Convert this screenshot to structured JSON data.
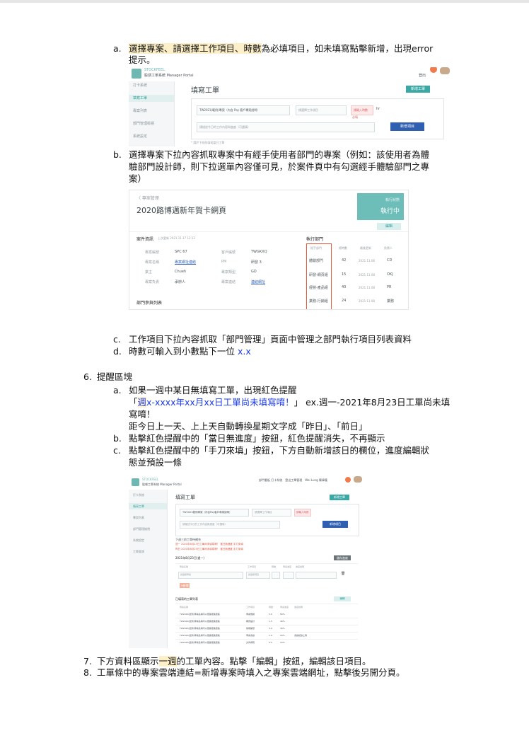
{
  "doc": {
    "item_a_marker": "a.",
    "item_a_line1_parts": [
      "選擇專案、請選擇工作項目、時數",
      "為必填項目，如未填寫點擊新增，出現error"
    ],
    "item_a_line2": "提示。",
    "item_b_marker": "b.",
    "item_b_lines": [
      "選擇專案下拉內容抓取專案中有經手使用者部門的專案（例如：該使用者為體",
      "驗部門設計師，則下拉選單內容僅可見，於案件頁中有勾選經手體驗部門之專",
      "案）"
    ],
    "item_c_marker": "c.",
    "item_c_text": "工作項目下拉內容抓取「部門管理」頁面中管理之部門執行項目列表資料",
    "item_d_marker": "d.",
    "item_d_text": "時數可輸入到小數點下一位",
    "item_d_blue": "x.x",
    "section6_marker": "6.",
    "section6_title": "提醒區塊",
    "s6a_marker": "a.",
    "s6a_line1": "如果一週中某日無填寫工單，出現紅色提醒",
    "s6a_line2_open": "「",
    "s6a_line2_hl": "週",
    "s6a_line2_blue": "x-xxxx年xx月xx日工單尚未填寫唷！",
    "s6a_line2_close": "」",
    "s6a_line2_rest": "ex.週一-2021年8月23日工單尚未填",
    "s6a_line3": "寫唷！",
    "s6a_line4": "距今日上一天、上上天自動轉換星期文字成「昨日」、「前日」",
    "s6b_marker": "b.",
    "s6b_text": "點擊紅色提醒中的「當日無進度」按鈕，紅色提醒消失，不再顯示",
    "s6c_marker": "c.",
    "s6c_line1": "點擊紅色提醒中的「手刀來填」按鈕，下方自動新增該日的欄位，進度編輯狀",
    "s6c_line2": "態並預設一條",
    "item7_marker": "7.",
    "item7_pre": "下方資料區顯示",
    "item7_hl": "一週",
    "item7_post": "的工單內容。點擊「編輯」按鈕，編輯該日項目。",
    "item8_marker": "8.",
    "item8_text": "工單條中的專案雲端連結=新增專案時填入之專案雲端網址，點擊後另開分頁。"
  },
  "shot1": {
    "brand_en": "STOCKFEEL",
    "brand_cn": "股感工單系統",
    "brand_sub": "Manager Portal",
    "user_label": "登出",
    "sidebar": [
      "打卡系統",
      "填寫工單",
      "專案列表",
      "部門管理檢視",
      "系統設定"
    ],
    "page_title": "填寫工單",
    "top_button": "新增工單",
    "project_select": "TW2021(範例)專案（內含 Pay 客戶專案說明）",
    "item_select": "請選擇工作項目",
    "hours_input": "請輸入時數",
    "hours_unit": "hr",
    "error_hint": "必填",
    "note_input": "請描述今日的工作內容與進度（可選填）",
    "submit_button": "新增項目",
    "footnote": "* 請於下班前填寫當日工單"
  },
  "shot2": {
    "back": "〈 專案管理",
    "title": "2020路博邁新年賀卡網頁",
    "status_small": "執行狀態",
    "status_big": "執行中",
    "edit_button": "編輯",
    "info_title": "案件資訊",
    "info_date": "上次更新 2021.11.17 12:13",
    "info_left_labels": [
      "專案編號",
      "專案名稱",
      "業主",
      "專案負責"
    ],
    "info_left_values": [
      "SPC 67",
      "專案網址連結",
      "Chueh",
      "承辦人"
    ],
    "info_right_labels": [
      "客戶編號",
      "PM",
      "專案類型",
      "專案連結"
    ],
    "info_right_values": [
      "TWGKXQ",
      "研發 3",
      "GD",
      "連結網址"
    ],
    "exec_title": "執行部門",
    "exec_headers": [
      "經手部門",
      "總時數",
      "最後更新",
      "負責人"
    ],
    "exec_depts": [
      "體驗部門",
      "研發-網頁組",
      "經營-產品組",
      "業務-行銷組"
    ],
    "exec_hours": [
      "42",
      "15",
      "40",
      "24"
    ],
    "exec_dates": [
      "2021.11.08",
      "2021.11.08",
      "2021.11.08",
      "2021.11.08"
    ],
    "exec_people": [
      "CD",
      "OKJ",
      "PR",
      "業務"
    ],
    "bottom_title": "部門參與列表"
  },
  "shot3": {
    "brand_en": "STOCKFEEL",
    "brand_cn": "股感工單系統",
    "brand_sub": "Manager Portal",
    "top_links": "部門看板 打卡系統　登出工單管理　Wei Lung 陳偉龍",
    "sidebar": [
      "打卡系統",
      "填寫工單",
      "專案列表",
      "部門管理檢視",
      "系統設定",
      "工單查詢"
    ],
    "page_title": "填寫工單",
    "top_button": "新增工單",
    "project_select": "TW2021範例專案（內含Pay客戶專案說明）",
    "item_select": "請選擇工作項目",
    "hours_input": "請輸入時數",
    "note_input": "請描述今日的工作內容與進度（可選填）",
    "submit_button": "新增項目",
    "reminder_title": "下週三前工單待補充",
    "reminder_1": "週一 2021年8月23日工單尚未填寫唷！ 當日無進度 手刀來填",
    "reminder_2": "昨日 2021年8月25日工單尚未填寫唷！ 當日無進度 手刀來填",
    "date_title": "2021年8月23日(週一)",
    "date_button": "儲存進度",
    "form_headers": [
      "專案名稱",
      "工作項目",
      "時數",
      "專案進度",
      "進度說明"
    ],
    "form_select1": "請選擇專案",
    "form_select2": "請選擇項目",
    "add_chip": "+新增",
    "list_title": "已填寫的工單列表",
    "list_button": "編輯",
    "list_headers": [
      "專案名稱",
      "工作項目",
      "時數",
      "專案進度",
      "進度說明"
    ],
    "list_rows": [
      [
        "TW2021(範例)專案名稱可以很長很長很長",
        "專案規劃",
        "2.0",
        "50%",
        ""
      ],
      [
        "TW2021(範例)專案名稱可以很長很長很長",
        "網頁設計",
        "1.5",
        "40%",
        ""
      ],
      [
        "TW2021(範例)專案名稱可以很長很長很長",
        "前端開發",
        "3.0",
        "30%",
        ""
      ],
      [
        "TW2021(範例)專案名稱可以很長很長很長",
        "專案會議",
        "1.0",
        "20%",
        "會議紀錄上傳"
      ],
      [
        "TW2021(範例)專案名稱可以很長很長很長",
        "文件撰寫",
        "0.5",
        "10%",
        ""
      ]
    ]
  }
}
